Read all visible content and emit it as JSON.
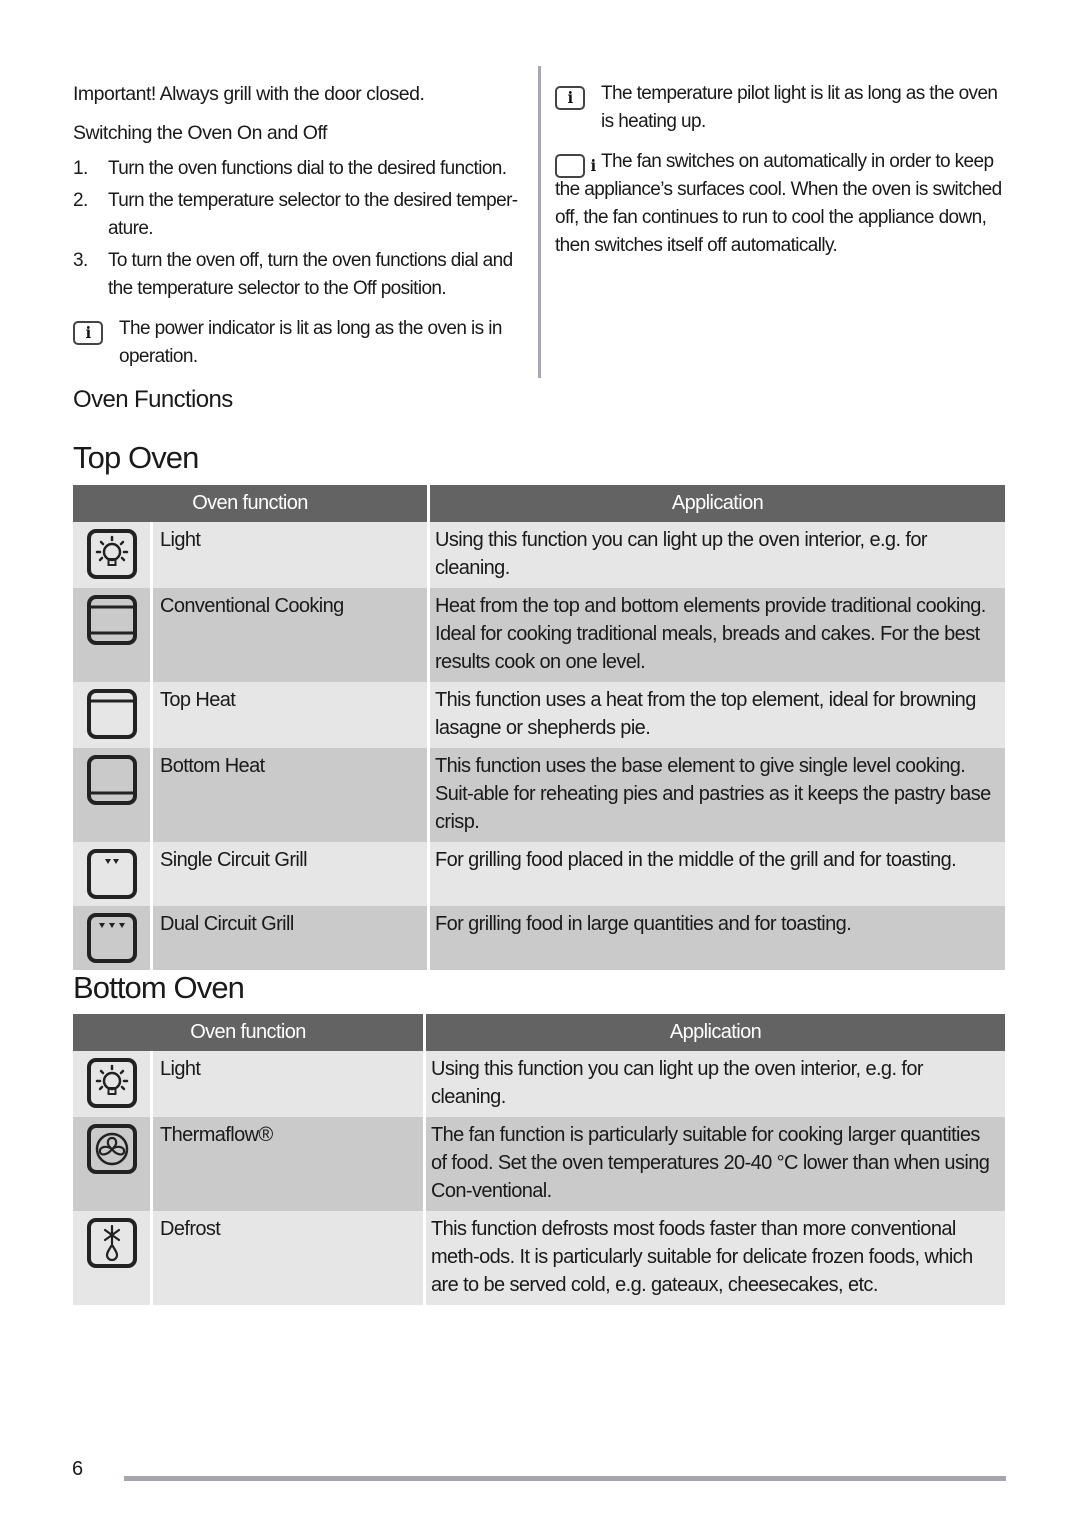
{
  "left_column": {
    "important": "Important!  Always grill with the door closed.",
    "switching_heading": "Switching the Oven On and Off",
    "steps": [
      {
        "num": "1.",
        "text": "Turn the oven functions dial to the desired function."
      },
      {
        "num": "2.",
        "text": "Turn the temperature selector to the desired temper-ature."
      },
      {
        "num": "3.",
        "text": "To turn the oven off, turn the oven functions dial and the temperature selector to the Off position."
      }
    ],
    "note": "The power indicator is lit as long as the oven is in operation."
  },
  "right_column": {
    "notes": [
      "The temperature pilot light is lit as long as the oven is heating up.",
      "The fan switches on automatically in order to keep the appliance’s surfaces cool. When the oven is switched off, the fan continues to run to cool the appliance down, then switches itself off automatically."
    ]
  },
  "info_icon_glyph": "i",
  "oven_functions_heading": "Oven Functions",
  "top_oven": {
    "title": "Top Oven",
    "headers": {
      "function": "Oven function",
      "application": "Application"
    },
    "rows": [
      {
        "icon": "light-icon",
        "name": "Light",
        "application": "Using this function you can light up the oven interior, e.g. for cleaning."
      },
      {
        "icon": "conventional-cooking-icon",
        "name": "Conventional Cooking",
        "application": "Heat from the top and bottom elements provide traditional cooking. Ideal for cooking traditional meals, breads and cakes. For the best results cook on one level."
      },
      {
        "icon": "top-heat-icon",
        "name": "Top Heat",
        "application": "This function uses a heat from the top element, ideal for browning lasagne or shepherds pie."
      },
      {
        "icon": "bottom-heat-icon",
        "name": "Bottom Heat",
        "application": "This function uses the base element to give single level cooking. Suit-able for reheating pies and pastries as it keeps the pastry base crisp."
      },
      {
        "icon": "single-circuit-grill-icon",
        "name": "Single Circuit Grill",
        "application": "For grilling food placed in the middle of the grill and for toasting."
      },
      {
        "icon": "dual-circuit-grill-icon",
        "name": "Dual Circuit Grill",
        "application": "For grilling food in large quantities and for toasting."
      }
    ]
  },
  "bottom_oven": {
    "title": "Bottom Oven",
    "headers": {
      "function": "Oven function",
      "application": "Application"
    },
    "rows": [
      {
        "icon": "light-icon",
        "name": "Light",
        "application": "Using this function you can light up the oven interior, e.g. for cleaning."
      },
      {
        "icon": "thermaflow-fan-icon",
        "name": "Thermaflow®",
        "application": "The fan function is particularly suitable for cooking larger quantities of food. Set the oven temperatures 20-40 °C lower than when using Con-ventional."
      },
      {
        "icon": "defrost-icon",
        "name": "Defrost",
        "application": "This function defrosts most foods faster than more conventional meth-ods. It is particularly suitable for delicate frozen foods, which are to be served cold, e.g. gateaux, cheesecakes, etc."
      }
    ]
  },
  "footer": {
    "page_number": "6"
  },
  "colors": {
    "table_header": "#636363",
    "row_light": "#e6e6e6",
    "row_dark": "#cacaca",
    "divider": "#a7a7b3",
    "footer_rule": "#a3a6ad"
  }
}
